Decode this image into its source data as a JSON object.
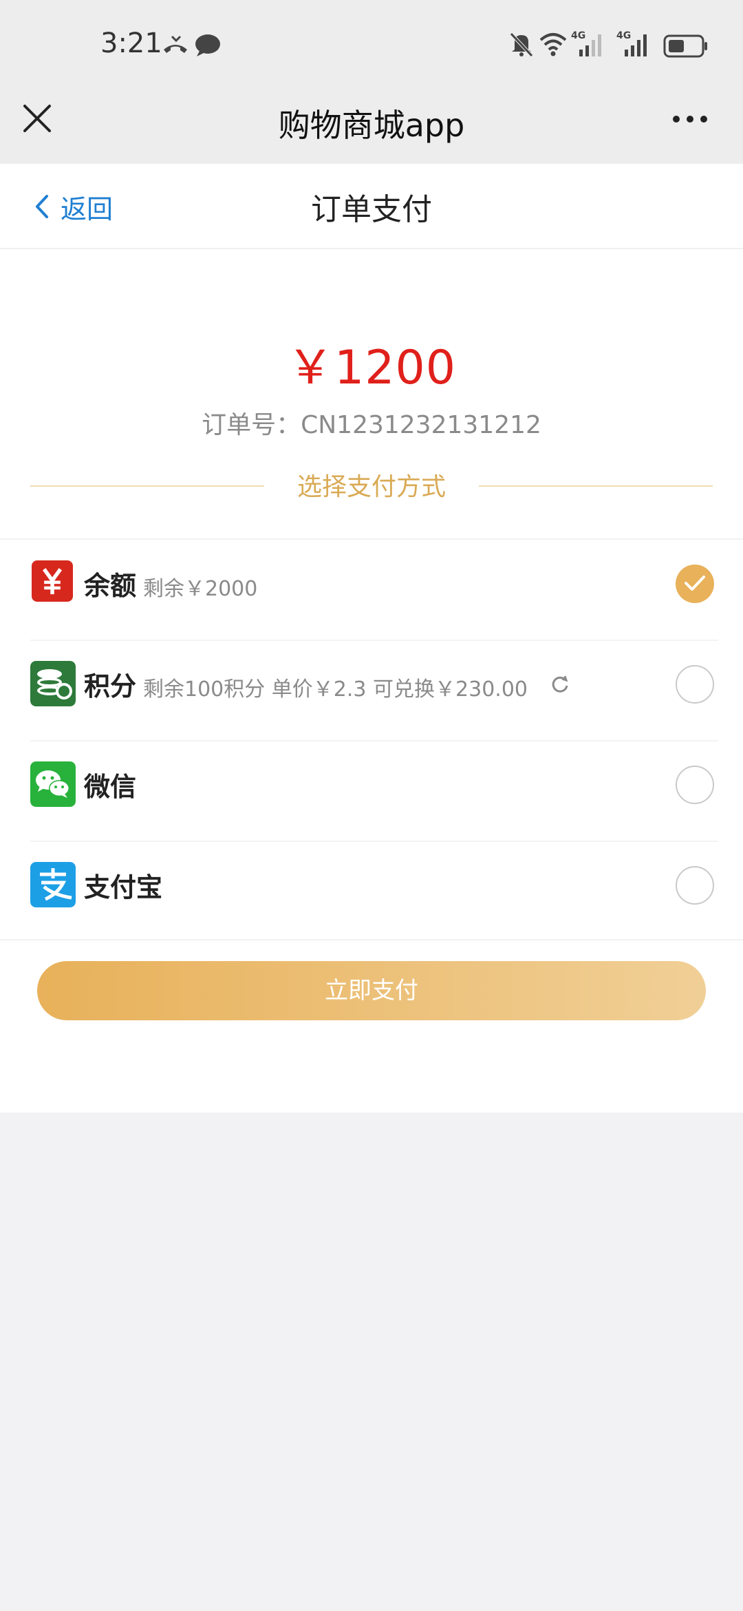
{
  "status_bar": {
    "time": "3:21",
    "icons": [
      "missed-call-icon",
      "message-icon",
      "bell-muted-icon",
      "wifi-icon",
      "signal-4g-icon",
      "signal-4g-icon",
      "battery-icon"
    ],
    "network_label_1": "4G",
    "network_label_2": "4G"
  },
  "app_bar": {
    "title": "购物商城app",
    "close_icon": "close-icon",
    "more_icon": "more-icon"
  },
  "nav": {
    "back_label": "返回",
    "title": "订单支付"
  },
  "order": {
    "amount": "￥1200",
    "order_no_label": "订单号：",
    "order_no": "CN1231232131212"
  },
  "section_title": "选择支付方式",
  "methods": [
    {
      "name": "余额",
      "desc": "剩余￥2000",
      "icon": "balance-yen-icon",
      "selected": true
    },
    {
      "name": "积分",
      "desc": "剩余100积分  单价￥2.3  可兑换￥230.00",
      "icon": "points-coins-icon",
      "selected": false
    },
    {
      "name": "微信",
      "desc": "",
      "icon": "wechat-icon",
      "selected": false
    },
    {
      "name": "支付宝",
      "desc": "",
      "icon": "alipay-icon",
      "selected": false
    }
  ],
  "pay_button_label": "立即支付",
  "colors": {
    "accent": "#e8b15a",
    "amount": "#e0201b",
    "link": "#1f7fd2",
    "wechat": "#28b23c",
    "alipay": "#1d9fe6",
    "balance": "#d7281e",
    "points": "#2d7a3a"
  }
}
